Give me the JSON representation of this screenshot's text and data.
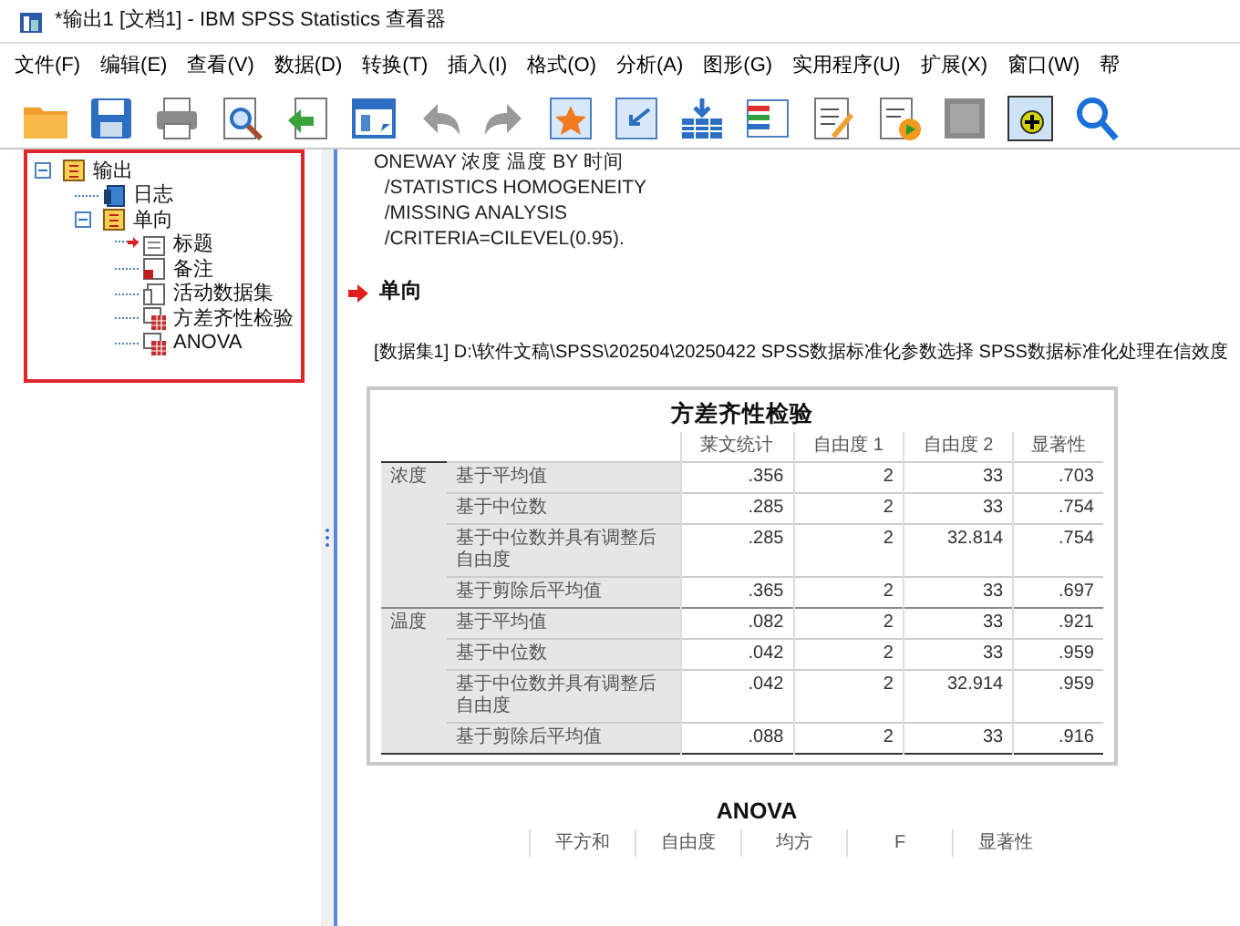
{
  "window": {
    "title": "*输出1 [文档1] - IBM SPSS Statistics 查看器"
  },
  "menu": [
    "文件(F)",
    "编辑(E)",
    "查看(V)",
    "数据(D)",
    "转换(T)",
    "插入(I)",
    "格式(O)",
    "分析(A)",
    "图形(G)",
    "实用程序(U)",
    "扩展(X)",
    "窗口(W)",
    "帮"
  ],
  "outline": [
    {
      "label": "输出",
      "kind": "folder",
      "current": false,
      "expanded": true,
      "children": [
        {
          "label": "日志",
          "kind": "log",
          "current": false
        },
        {
          "label": "单向",
          "kind": "folder",
          "current": false,
          "expanded": true,
          "children": [
            {
              "label": "标题",
              "kind": "title",
              "current": true
            },
            {
              "label": "备注",
              "kind": "notes",
              "current": false
            },
            {
              "label": "活动数据集",
              "kind": "text",
              "current": false
            },
            {
              "label": "方差齐性检验",
              "kind": "table",
              "current": false
            },
            {
              "label": "ANOVA",
              "kind": "table",
              "current": false
            }
          ]
        }
      ]
    }
  ],
  "syntax": [
    "ONEWAY 浓度 温度 BY 时间",
    "  /STATISTICS HOMOGENEITY",
    "  /MISSING ANALYSIS",
    "  /CRITERIA=CILEVEL(0.95)."
  ],
  "heading": "单向",
  "dataset": "[数据集1] D:\\软件文稿\\SPSS\\202504\\20250422 SPSS数据标准化参数选择 SPSS数据标准化处理在信效度",
  "homogeneity_table": {
    "title": "方差齐性检验",
    "columns": [
      "莱文统计",
      "自由度 1",
      "自由度 2",
      "显著性"
    ],
    "groups": [
      {
        "name": "浓度",
        "rows": [
          {
            "label": "基于平均值",
            "values": [
              ".356",
              "2",
              "33",
              ".703"
            ]
          },
          {
            "label": "基于中位数",
            "values": [
              ".285",
              "2",
              "33",
              ".754"
            ]
          },
          {
            "label": "基于中位数并具有调整后自由度",
            "values": [
              ".285",
              "2",
              "32.814",
              ".754"
            ]
          },
          {
            "label": "基于剪除后平均值",
            "values": [
              ".365",
              "2",
              "33",
              ".697"
            ]
          }
        ]
      },
      {
        "name": "温度",
        "rows": [
          {
            "label": "基于平均值",
            "values": [
              ".082",
              "2",
              "33",
              ".921"
            ]
          },
          {
            "label": "基于中位数",
            "values": [
              ".042",
              "2",
              "33",
              ".959"
            ]
          },
          {
            "label": "基于中位数并具有调整后自由度",
            "values": [
              ".042",
              "2",
              "32.914",
              ".959"
            ]
          },
          {
            "label": "基于剪除后平均值",
            "values": [
              ".088",
              "2",
              "33",
              ".916"
            ]
          }
        ]
      }
    ]
  },
  "anova_table": {
    "title": "ANOVA",
    "columns": [
      "平方和",
      "自由度",
      "均方",
      "F",
      "显著性"
    ]
  }
}
